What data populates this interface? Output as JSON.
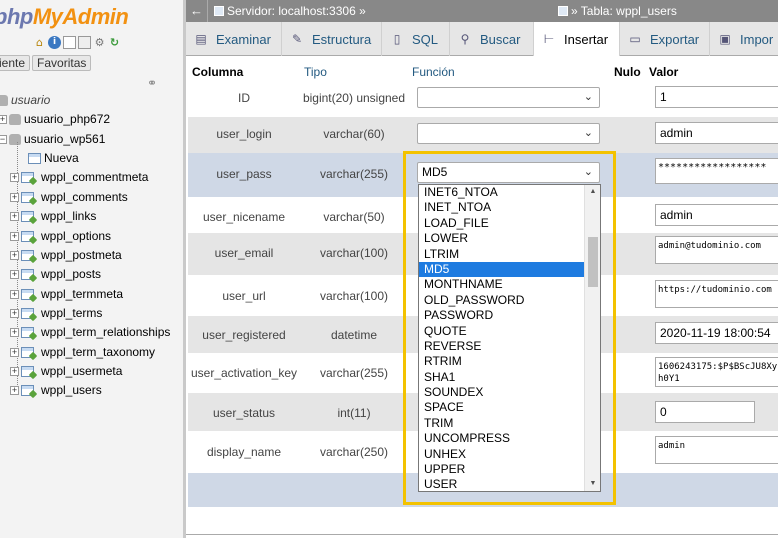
{
  "app": {
    "logo_php": "php",
    "logo_myadmin": "MyAdmin"
  },
  "nav": {
    "tabs": [
      {
        "label": "iente"
      },
      {
        "label": "Favoritas"
      }
    ],
    "tree": {
      "root": "usuario",
      "db1": "usuario_php672",
      "db2": "usuario_wp561",
      "new_label": "Nueva",
      "tables": [
        "wppl_commentmeta",
        "wppl_comments",
        "wppl_links",
        "wppl_options",
        "wppl_postmeta",
        "wppl_posts",
        "wppl_termmeta",
        "wppl_terms",
        "wppl_term_relationships",
        "wppl_term_taxonomy",
        "wppl_usermeta",
        "wppl_users"
      ]
    }
  },
  "topbar": {
    "server": "Servidor: localhost:3306 »",
    "table": "» Tabla: wppl_users"
  },
  "tabs": [
    {
      "label": "Examinar",
      "icon": "browse-icon"
    },
    {
      "label": "Estructura",
      "icon": "structure-icon"
    },
    {
      "label": "SQL",
      "icon": "sql-icon"
    },
    {
      "label": "Buscar",
      "icon": "search-icon"
    },
    {
      "label": "Insertar",
      "icon": "insert-icon",
      "active": true
    },
    {
      "label": "Exportar",
      "icon": "export-icon"
    },
    {
      "label": "Impor",
      "icon": "import-icon"
    }
  ],
  "table": {
    "headers": {
      "column": "Columna",
      "type": "Tipo",
      "function": "Función",
      "null": "Nulo",
      "value": "Valor"
    },
    "rows": [
      {
        "name": "ID",
        "type": "bigint(20) unsigned",
        "function": "",
        "value": "1"
      },
      {
        "name": "user_login",
        "type": "varchar(60)",
        "function": "",
        "value": "admin"
      },
      {
        "name": "user_pass",
        "type": "varchar(255)",
        "function": "MD5",
        "value": "******************"
      },
      {
        "name": "user_nicename",
        "type": "varchar(50)",
        "function": "",
        "value": "admin"
      },
      {
        "name": "user_email",
        "type": "varchar(100)",
        "function": "",
        "value": "admin@tudominio.com"
      },
      {
        "name": "user_url",
        "type": "varchar(100)",
        "function": "",
        "value": "https://tudominio.com"
      },
      {
        "name": "user_registered",
        "type": "datetime",
        "function": "",
        "value": "2020-11-19 18:00:54"
      },
      {
        "name": "user_activation_key",
        "type": "varchar(255)",
        "function": "",
        "value": "1606243175:$P$BScJU8Xy",
        "value_line2": "h0Y1"
      },
      {
        "name": "user_status",
        "type": "int(11)",
        "function": "",
        "value": "0"
      },
      {
        "name": "display_name",
        "type": "varchar(250)",
        "function": "",
        "value": "admin"
      }
    ]
  },
  "dropdown": {
    "options": [
      "INET6_NTOA",
      "INET_NTOA",
      "LOAD_FILE",
      "LOWER",
      "LTRIM",
      "MD5",
      "MONTHNAME",
      "OLD_PASSWORD",
      "PASSWORD",
      "QUOTE",
      "REVERSE",
      "RTRIM",
      "SHA1",
      "SOUNDEX",
      "SPACE",
      "TRIM",
      "UNCOMPRESS",
      "UNHEX",
      "UPPER",
      "USER"
    ],
    "selected": "MD5",
    "scroll_up": "▲",
    "scroll_down": "▼"
  },
  "colors": {
    "highlight": "#f3c200",
    "selected_option": "#1e7be0",
    "link": "#235a81"
  }
}
